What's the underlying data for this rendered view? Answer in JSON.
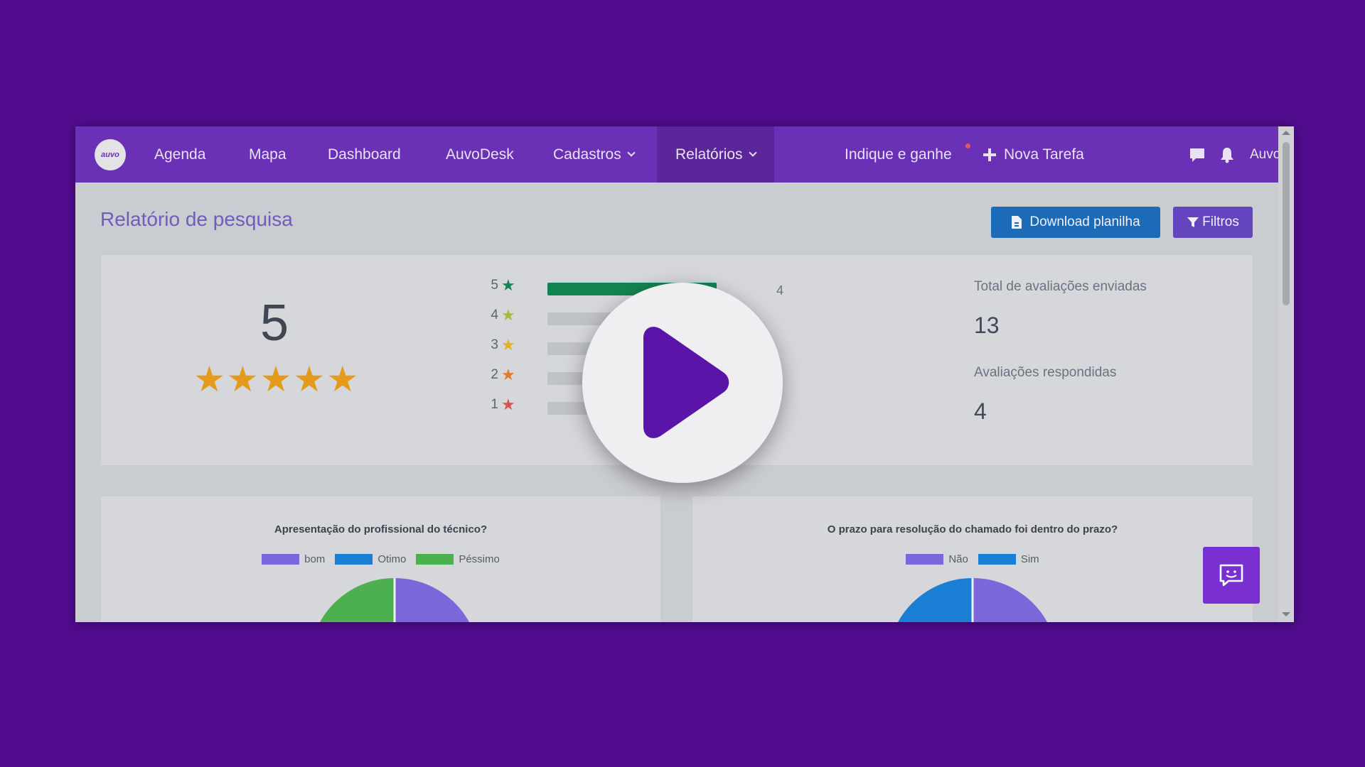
{
  "nav": {
    "logo_text": "auvo",
    "items": [
      "Agenda",
      "Mapa",
      "Dashboard",
      "AuvoDesk"
    ],
    "cadastros": "Cadastros",
    "relatorios": "Relatórios",
    "indique": "Indique e ganhe",
    "nova_tarefa": "Nova Tarefa",
    "user": "Auvo CS"
  },
  "page": {
    "title": "Relatório de pesquisa",
    "download_label": "Download planilha",
    "filtros_label": "Filtros"
  },
  "summary": {
    "score": "5",
    "star_count": 5,
    "ratings": [
      {
        "level": "5",
        "count": "4",
        "fill_fraction": 1.0,
        "color": "#138451"
      },
      {
        "level": "4",
        "color": "#a8b83a"
      },
      {
        "level": "3",
        "color": "#e3b21c"
      },
      {
        "level": "2",
        "color": "#e57b22"
      },
      {
        "level": "1",
        "color": "#d9534f"
      }
    ],
    "total_label": "Total de avaliações enviadas",
    "total_value": "13",
    "responded_label": "Avaliações respondidas",
    "responded_value": "4"
  },
  "charts": {
    "left": {
      "title": "Apresentação do profissional do técnico?",
      "legend": [
        {
          "label": "bom",
          "color": "#7b67d9"
        },
        {
          "label": "Otimo",
          "color": "#1a7fd4"
        },
        {
          "label": "Péssimo",
          "color": "#4caf50"
        }
      ]
    },
    "right": {
      "title": "O prazo para resolução do chamado foi dentro do prazo?",
      "legend": [
        {
          "label": "Não",
          "color": "#7b67d9"
        },
        {
          "label": "Sim",
          "color": "#1a7fd4"
        }
      ]
    }
  },
  "colors": {
    "background": "#500c8c",
    "navbar": "#6a30b6",
    "accent_star": "#e49b1b",
    "play_icon": "#5a14a8"
  },
  "icons": [
    "file-icon",
    "filter-icon",
    "plus-icon",
    "chat-icon",
    "bell-icon",
    "star-icon",
    "play-icon",
    "feedback-chat-icon"
  ]
}
